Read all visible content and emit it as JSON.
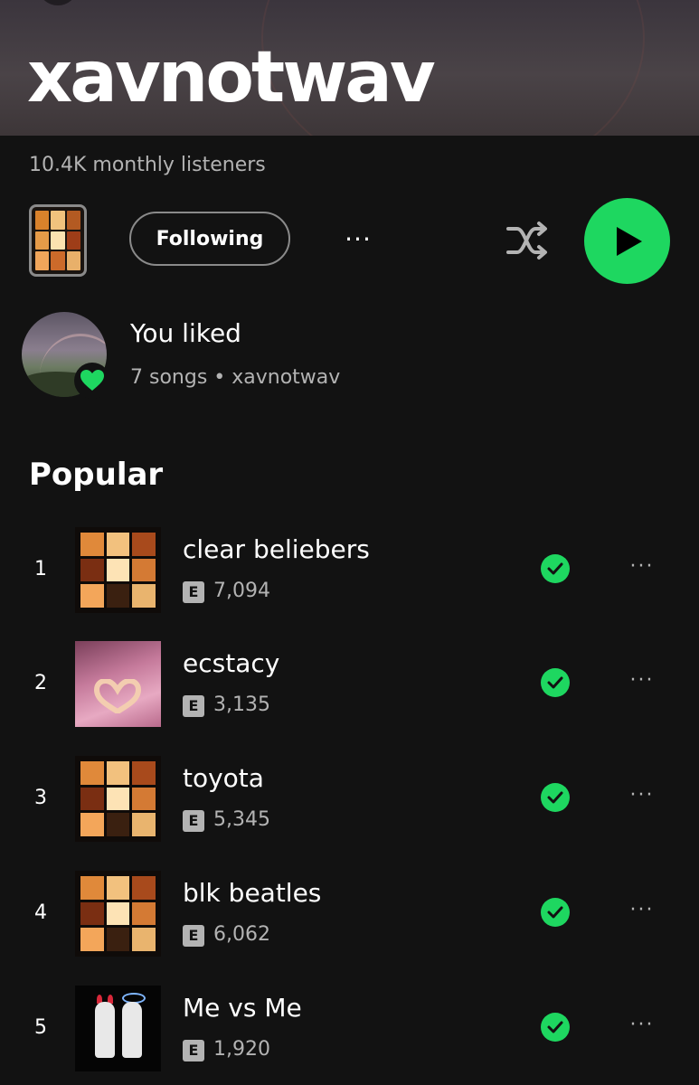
{
  "artist": {
    "name": "xavnotwav",
    "monthly_listeners": "10.4K monthly listeners"
  },
  "controls": {
    "following_label": "Following",
    "more_label": "···"
  },
  "liked": {
    "title": "You liked",
    "subtitle": "7 songs • xavnotwav"
  },
  "popular": {
    "heading": "Popular",
    "tracks": [
      {
        "rank": "1",
        "title": "clear beliebers",
        "explicit": "E",
        "plays": "7,094",
        "saved": true
      },
      {
        "rank": "2",
        "title": "ecstacy",
        "explicit": "E",
        "plays": "3,135",
        "saved": true
      },
      {
        "rank": "3",
        "title": "toyota",
        "explicit": "E",
        "plays": "5,345",
        "saved": true
      },
      {
        "rank": "4",
        "title": "blk beatles",
        "explicit": "E",
        "plays": "6,062",
        "saved": true
      },
      {
        "rank": "5",
        "title": "Me vs Me",
        "explicit": "E",
        "plays": "1,920",
        "saved": true
      }
    ],
    "track_more_label": "···"
  },
  "colors": {
    "background": "#121212",
    "accent_green": "#1ed760",
    "text_secondary": "#b3b3b3"
  },
  "icons": {
    "shuffle": "shuffle-icon",
    "play": "play-icon",
    "heart": "heart-icon",
    "saved": "check-circle-icon",
    "more": "more-horizontal-icon"
  }
}
